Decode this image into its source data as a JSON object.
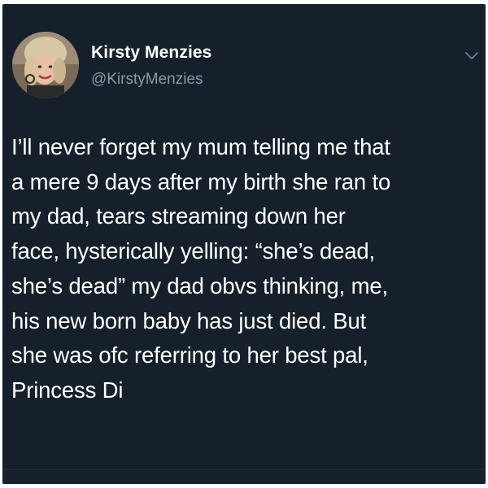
{
  "author": {
    "display_name": "Kirsty Menzies",
    "handle": "@KirstyMenzies"
  },
  "icons": {
    "menu": "chevron-down-icon"
  },
  "tweet": {
    "lines": [
      "I’ll never forget my mum telling me that",
      "a mere 9 days after my birth she ran to",
      "my dad, tears streaming down her",
      "face, hysterically yelling: “she’s dead,",
      "she’s dead” my dad obvs thinking, me,",
      "his new born baby has just died. But",
      "she was ofc referring to her best pal,",
      "Princess Di"
    ]
  },
  "colors": {
    "background": "#15202b",
    "primary_text": "#ffffff",
    "secondary_text": "#8899a6"
  }
}
